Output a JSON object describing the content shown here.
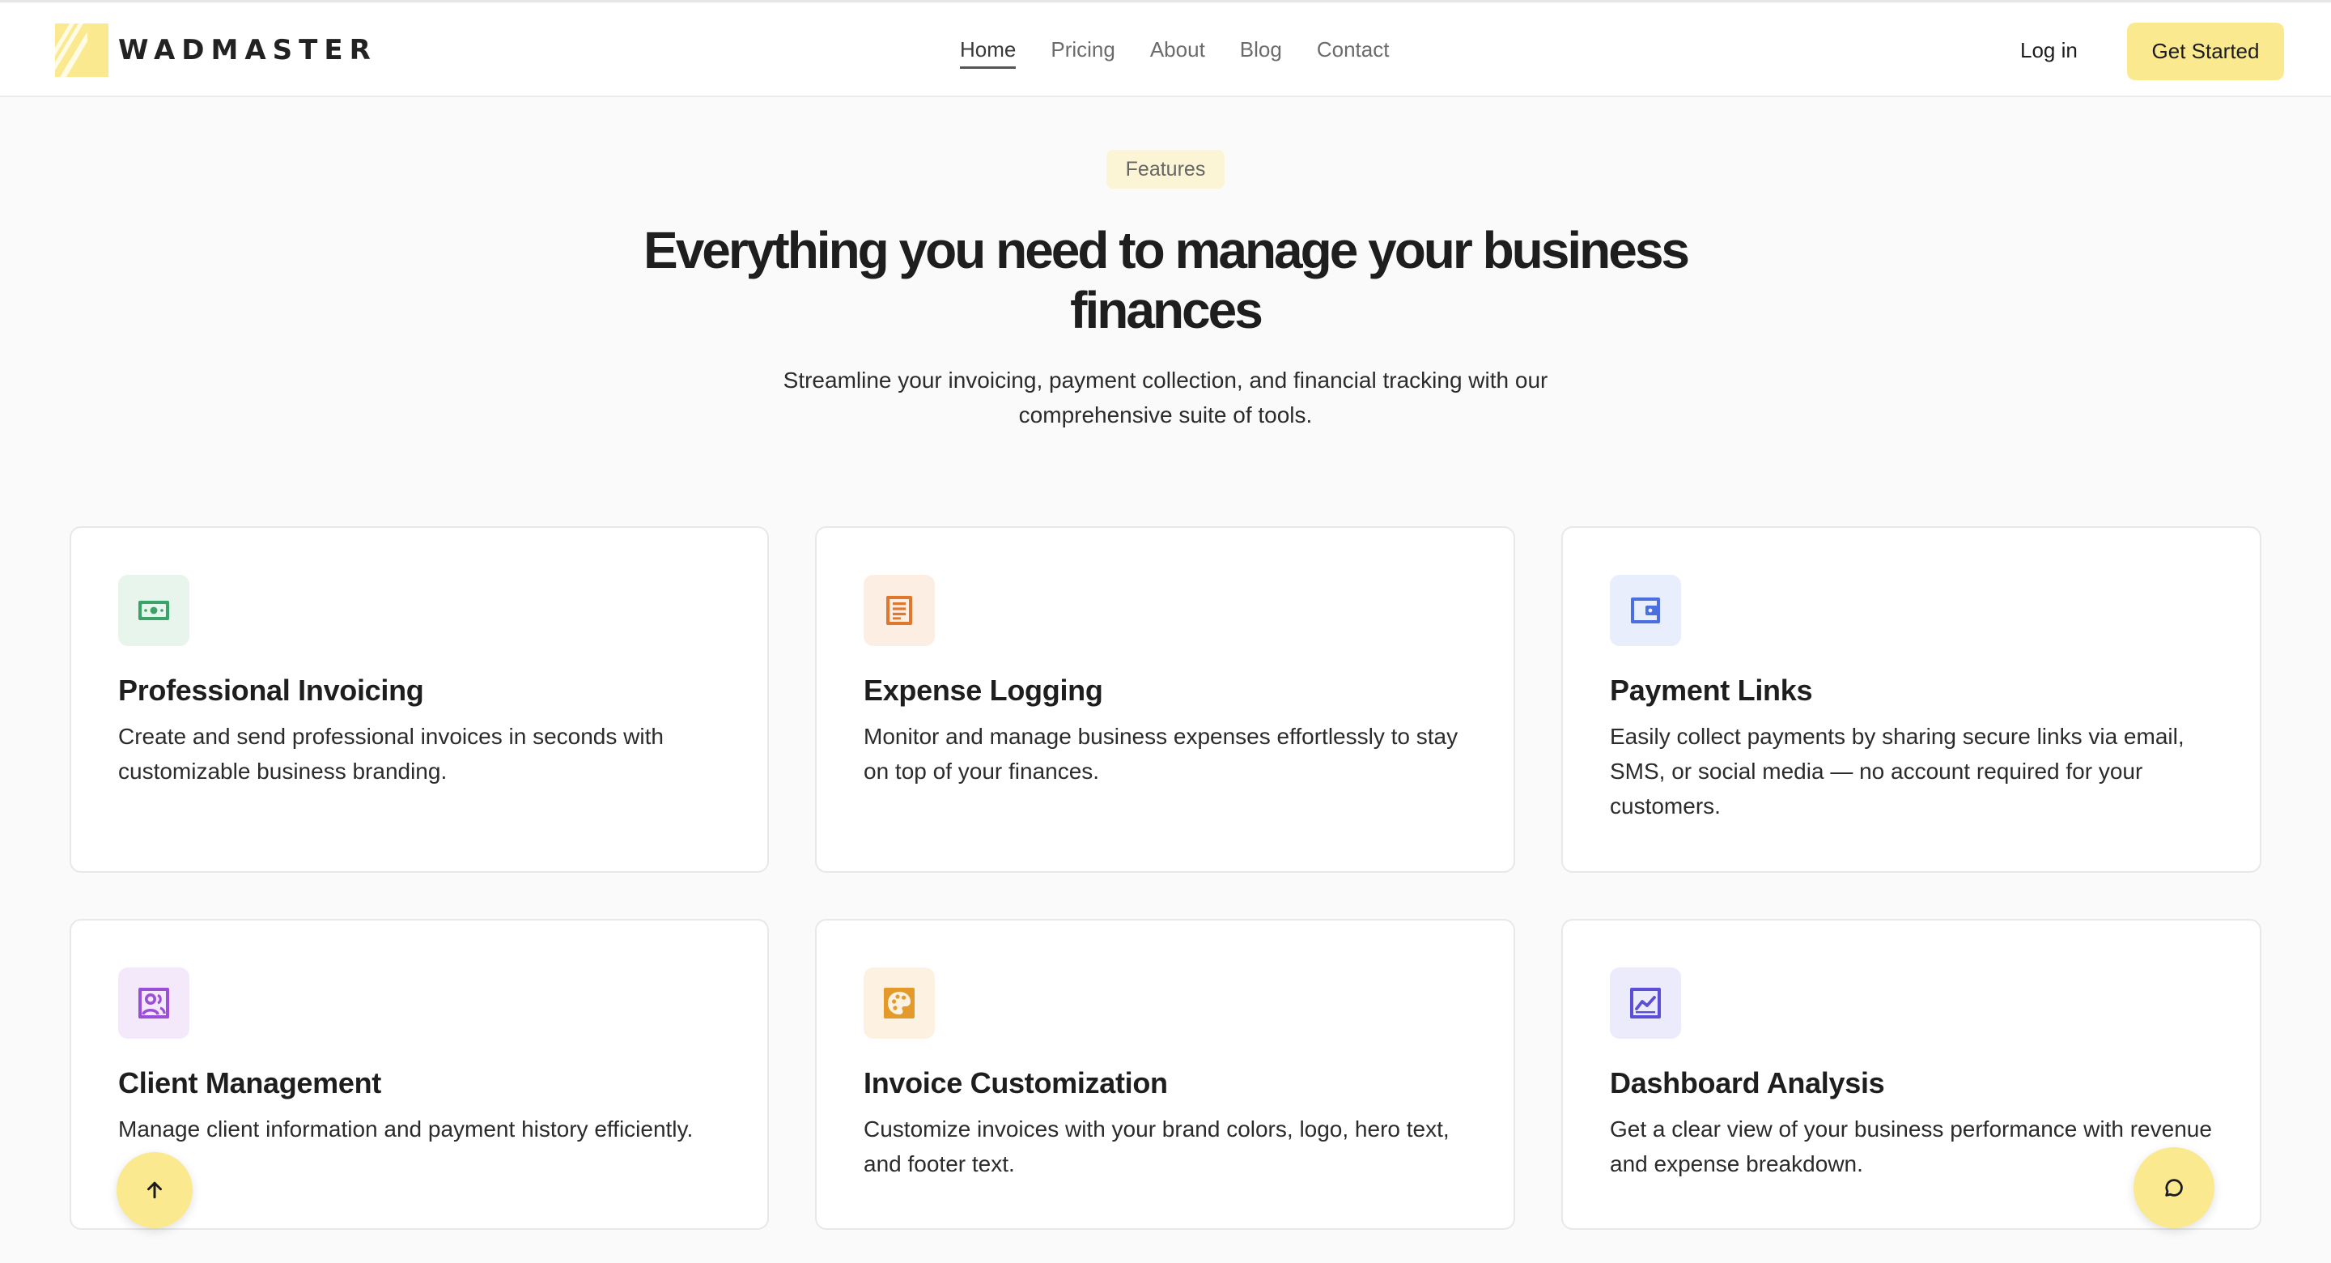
{
  "brand": {
    "name": "WADMASTER"
  },
  "nav": {
    "items": [
      {
        "label": "Home",
        "active": true
      },
      {
        "label": "Pricing",
        "active": false
      },
      {
        "label": "About",
        "active": false
      },
      {
        "label": "Blog",
        "active": false
      },
      {
        "label": "Contact",
        "active": false
      }
    ],
    "login_label": "Log in",
    "cta_label": "Get Started"
  },
  "hero": {
    "badge": "Features",
    "title_line1": "Everything you need to manage your business",
    "title_line2": "finances",
    "subtitle_line1": "Streamline your invoicing, payment collection, and financial tracking with our",
    "subtitle_line2": "comprehensive suite of tools."
  },
  "features": [
    {
      "title": "Professional Invoicing",
      "description": "Create and send professional invoices in seconds with customizable business branding.",
      "icon": "banknote-icon",
      "icon_color": "#3aa36a",
      "icon_bg": "#e7f5ec"
    },
    {
      "title": "Expense Logging",
      "description": "Monitor and manage business expenses effortlessly to stay on top of your finances.",
      "icon": "receipt-icon",
      "icon_color": "#e0772f",
      "icon_bg": "#fdeee4"
    },
    {
      "title": "Payment Links",
      "description": "Easily collect payments by sharing secure links via email, SMS, or social media — no account required for your customers.",
      "icon": "wallet-icon",
      "icon_color": "#4b6fe0",
      "icon_bg": "#e9eefc"
    },
    {
      "title": "Client Management",
      "description": "Manage client information and payment history efficiently.",
      "icon": "users-icon",
      "icon_color": "#9b4fd8",
      "icon_bg": "#f3e9fb"
    },
    {
      "title": "Invoice Customization",
      "description": "Customize invoices with your brand colors, logo, hero text, and footer text.",
      "icon": "palette-icon",
      "icon_color": "#e39a2a",
      "icon_bg": "#fdf2e2"
    },
    {
      "title": "Dashboard Analysis",
      "description": "Get a clear view of your business performance with revenue and expense breakdown.",
      "icon": "chart-icon",
      "icon_color": "#5a4fd6",
      "icon_bg": "#ecebfb"
    }
  ],
  "colors": {
    "accent": "#fae98f",
    "badge_bg": "#fbf5d5",
    "page_bg": "#fafafa"
  },
  "floating": {
    "scroll_top_icon": "arrow-up-icon",
    "chat_icon": "chat-bubble-icon"
  }
}
